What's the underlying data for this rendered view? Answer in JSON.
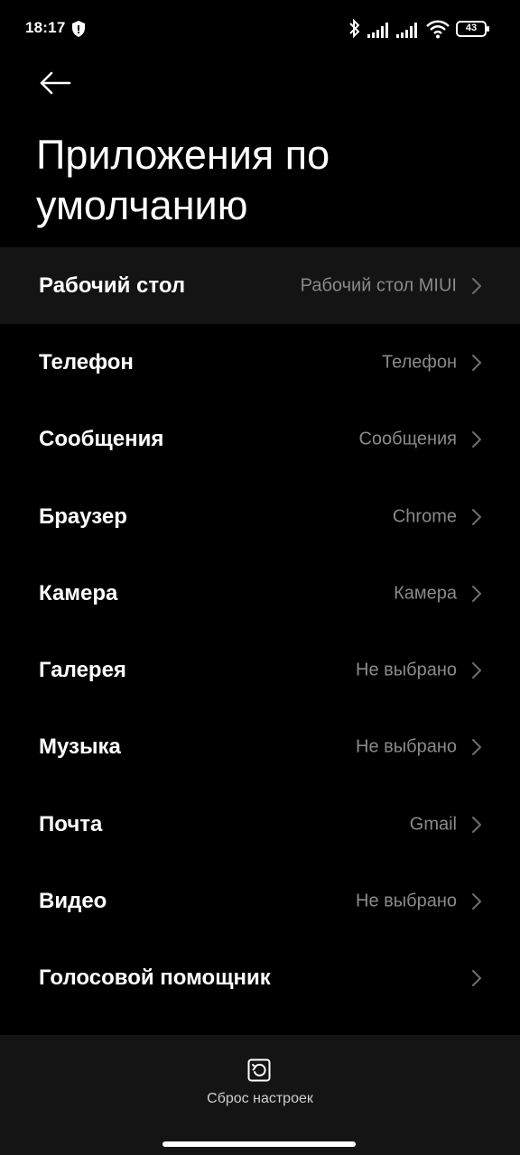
{
  "status_bar": {
    "time": "18:17",
    "battery": "43"
  },
  "header": {
    "title": "Приложения по умолчанию"
  },
  "items": [
    {
      "label": "Рабочий стол",
      "value": "Рабочий стол MIUI"
    },
    {
      "label": "Телефон",
      "value": "Телефон"
    },
    {
      "label": "Сообщения",
      "value": "Сообщения"
    },
    {
      "label": "Браузер",
      "value": "Chrome"
    },
    {
      "label": "Камера",
      "value": "Камера"
    },
    {
      "label": "Галерея",
      "value": "Не выбрано"
    },
    {
      "label": "Музыка",
      "value": "Не выбрано"
    },
    {
      "label": "Почта",
      "value": "Gmail"
    },
    {
      "label": "Видео",
      "value": "Не выбрано"
    },
    {
      "label": "Голосовой помощник",
      "value": ""
    }
  ],
  "footer": {
    "reset_label": "Сброс настроек"
  },
  "colors": {
    "background": "#000000",
    "highlight_row": "#141414",
    "value_text": "#8a8a8a"
  },
  "icons": {
    "back": "arrow-left-icon",
    "chevron": "chevron-right-icon",
    "reset": "reset-icon",
    "shield": "shield-icon",
    "bluetooth": "bluetooth-icon",
    "signal": "signal-icon",
    "wifi": "wifi-icon",
    "battery": "battery-icon"
  }
}
